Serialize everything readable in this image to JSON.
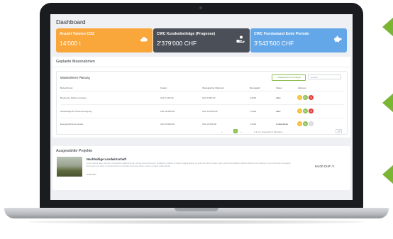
{
  "page": {
    "title": "Dashboard"
  },
  "colors": {
    "orange": "#f9a63a",
    "dark": "#4b5058",
    "blue": "#63a7e8",
    "green": "#8cc152",
    "yellow": "#f3bd2f",
    "red": "#e2413e"
  },
  "cards": [
    {
      "label": "Anzahl Tonnen CO2",
      "value": "14'000 t",
      "icon": "cloud-icon"
    },
    {
      "label": "CWC Kundenbeiträge (Prognose)",
      "value": "2'379'000 CHF",
      "icon": "hand-coin-icon"
    },
    {
      "label": "CWC Fondsstand Ende Periode",
      "value": "3'543'500 CHF",
      "icon": "piggy-bank-icon"
    }
  ],
  "planned": {
    "section_title": "Geplante Massnahmen",
    "table_title": "Massnahmen Planung",
    "new_button": "+ Massnahme hinzufügen",
    "search_placeholder": "Suchen",
    "headers": [
      "Bezeichnung",
      "Kosten",
      "Ökologischer Mehrwert",
      "Bezugsjahr",
      "Status",
      "Aktionen"
    ],
    "rows": [
      {
        "name": "Biodiverse Flächen anlegen",
        "cost": "CHF 1'200.00",
        "value": "CHF 1'800.00",
        "year": "0,2019",
        "status": "Aktiv"
      },
      {
        "name": "Solaranlage für Stromversorgung",
        "cost": "CHF 90'000.00",
        "value": "CHF 110'000.00",
        "year": "1,2019",
        "status": "Aktiv"
      },
      {
        "name": "Energieeffiziente Geräte",
        "cost": "CHF 18'000.00",
        "value": "CHF 22'000.00",
        "year": "1,2019",
        "status": "Unbearbeitet"
      }
    ],
    "pager": {
      "prev": "«",
      "page": "1",
      "next": "»",
      "info": "1-3 von insgesamt 3 Einträgen",
      "per_page": "10"
    }
  },
  "projects": {
    "section_title": "Ausgewählte Projekte",
    "items": [
      {
        "title": "Nachhaltige Landwirtschaft",
        "text": "Lorem ipsum dolor sit amet, consectetur adipiscing elit, sed do eiusmod tempor incididunt ut labore et dolore magna aliqua. Ut enim ad minim veniam, quis nostrud exercitation ullamco laboris nisi ut aliquip ex ea commodo consequat. Duis aute irure dolor in reprehenderit in voluptate velit esse cillum dolore eu fugiat nulla pariatur.",
        "meta": "HR-2017",
        "price": "64.00 CHF / t"
      }
    ]
  }
}
